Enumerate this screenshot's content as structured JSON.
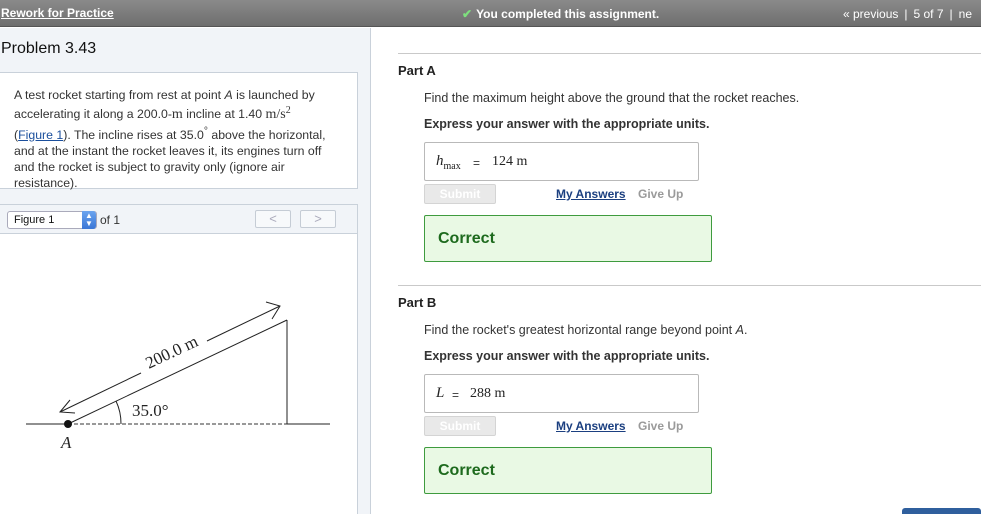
{
  "topbar": {
    "back_link": "Rework for Practice",
    "completed": "You completed this assignment.",
    "previous": "« previous",
    "position": "5 of 7",
    "next": "ne"
  },
  "problem": {
    "title": "Problem 3.43",
    "statement": {
      "p1": "A test rocket starting from rest at point ",
      "pointA": "A",
      "p2": " is launched by accelerating it along a 200.0-",
      "unit_m": "m",
      "p3": " incline at 1.40 ",
      "accel_unit": "m/s",
      "accel_exp": "2",
      "paren_open": "(",
      "figure_link": "Figure 1",
      "paren_close": ")",
      "p4": ". The incline rises at 35.0",
      "deg": "°",
      "p5": " above the horizontal, and at the instant the rocket leaves it, its engines turn off and the rocket is subject to gravity only (ignore air resistance)."
    }
  },
  "figure_viewer": {
    "selected": "Figure 1",
    "of_label": "of 1",
    "prev": "<",
    "next": ">",
    "diagram": {
      "length_label": "200.0 m",
      "angle_label": "35.0°",
      "point_label": "A"
    }
  },
  "part_a": {
    "title": "Part A",
    "question": "Find the maximum height above the ground that the rocket reaches.",
    "instruction": "Express your answer with the appropriate units.",
    "var": "h",
    "var_sub": "max",
    "equals": "=",
    "value": "124 m",
    "submit": "Submit",
    "my_answers": "My Answers",
    "give_up": "Give Up",
    "feedback": "Correct"
  },
  "part_b": {
    "title": "Part B",
    "question_pre": "Find the rocket's greatest horizontal range beyond point ",
    "question_point": "A",
    "question_post": ".",
    "instruction": "Express your answer with the appropriate units.",
    "var": "L",
    "equals": "=",
    "value": "288 m",
    "submit": "Submit",
    "my_answers": "My Answers",
    "give_up": "Give Up",
    "feedback": "Correct"
  },
  "colors": {
    "correct_border": "#3e9b3e",
    "correct_bg": "#e9f9e4",
    "link": "#1b4f9c",
    "topbar": "#777777"
  }
}
